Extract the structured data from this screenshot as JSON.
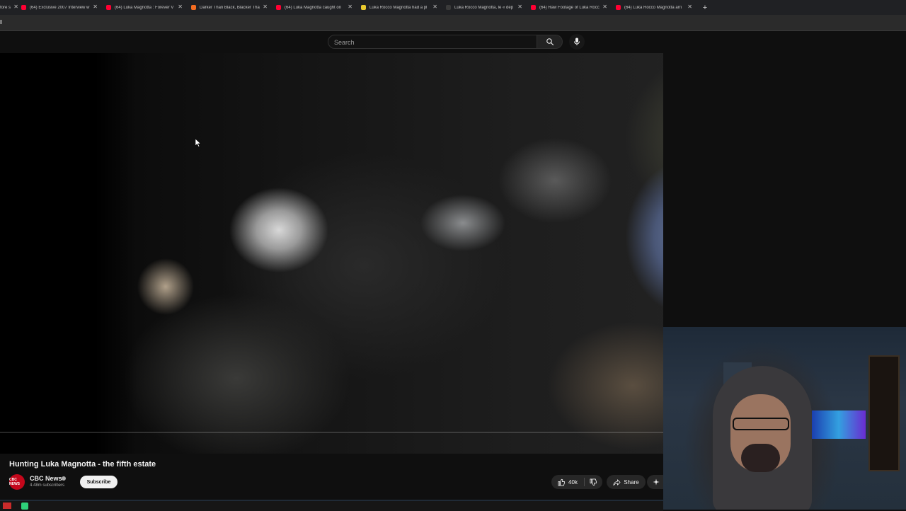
{
  "browser": {
    "tabs": [
      {
        "label": "fore s",
        "favicon_color": "#5f6368"
      },
      {
        "label": "(64) Exclusive 2007 Interview w",
        "favicon_color": "#ff0033"
      },
      {
        "label": "(64) Luka Magnotta : Forever V",
        "favicon_color": "#ff0033"
      },
      {
        "label": "Darker Than Black, Blacker Tha",
        "favicon_color": "#f36c21"
      },
      {
        "label": "(64) Luka Magnotta caught on",
        "favicon_color": "#ff0033"
      },
      {
        "label": "Luka Rocco Magnotta had a pl",
        "favicon_color": "#e8c92e"
      },
      {
        "label": "Luka Rocco Magnotta, le « dép",
        "favicon_color": "#3a3a3a"
      },
      {
        "label": "(64) Raw Footage of Luka Rocc",
        "favicon_color": "#ff0033"
      },
      {
        "label": "(64) Luka Rocco Magnotta arri",
        "favicon_color": "#ff0033"
      }
    ],
    "new_tab_label": "+"
  },
  "youtube": {
    "search_placeholder": "Search",
    "video": {
      "title": "Hunting Luka Magnotta - the fifth estate",
      "channel": "CBC News",
      "avatar_text": "CBC NEWS",
      "subscribers": "4.48m subscribers",
      "subscribe_label": "Subscribe",
      "likes": "40k",
      "share_label": "Share",
      "more_label": "+"
    }
  },
  "colors": {
    "accent": "#ff0033",
    "background": "#0f0f0f",
    "channel_avatar": "#c4071b"
  }
}
